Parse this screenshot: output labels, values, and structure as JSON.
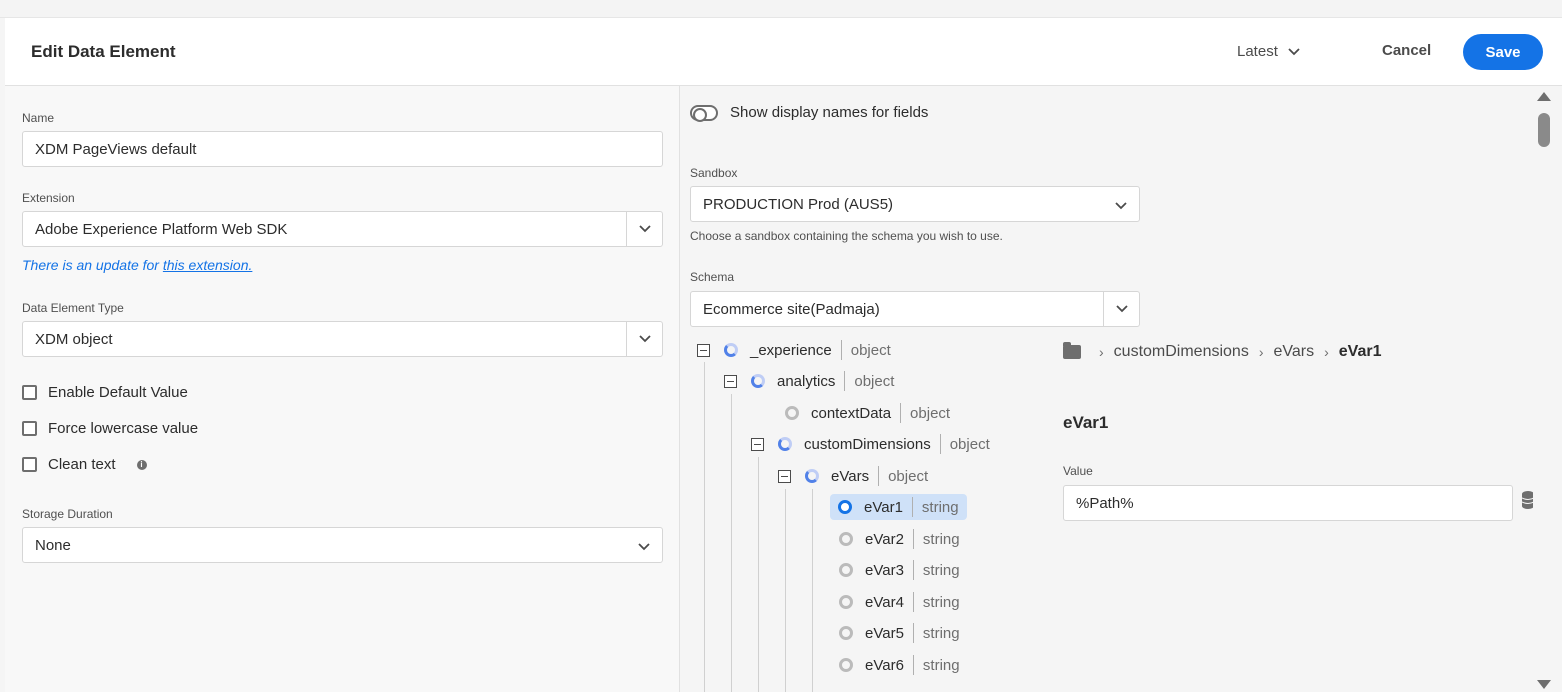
{
  "header": {
    "title": "Edit Data Element",
    "version": "Latest",
    "cancel_label": "Cancel",
    "save_label": "Save"
  },
  "left": {
    "name_label": "Name",
    "name_value": "XDM PageViews default",
    "extension_label": "Extension",
    "extension_value": "Adobe Experience Platform Web SDK",
    "update_note_prefix": "There is an update for ",
    "update_note_link": "this extension.",
    "type_label": "Data Element Type",
    "type_value": "XDM object",
    "checkboxes": [
      {
        "label": "Enable Default Value",
        "checked": false
      },
      {
        "label": "Force lowercase value",
        "checked": false
      },
      {
        "label": "Clean text",
        "checked": false
      }
    ],
    "storage_label": "Storage Duration",
    "storage_value": "None"
  },
  "right": {
    "toggle_label": "Show display names for fields",
    "sandbox_label": "Sandbox",
    "sandbox_value": "PRODUCTION Prod (AUS5)",
    "sandbox_helper": "Choose a sandbox containing the schema you wish to use.",
    "schema_label": "Schema",
    "schema_value": "Ecommerce site(Padmaja)",
    "tree": [
      {
        "name": "_experience",
        "type": "object"
      },
      {
        "name": "analytics",
        "type": "object"
      },
      {
        "name": "contextData",
        "type": "object"
      },
      {
        "name": "customDimensions",
        "type": "object"
      },
      {
        "name": "eVars",
        "type": "object"
      },
      {
        "name": "eVar1",
        "type": "string"
      },
      {
        "name": "eVar2",
        "type": "string"
      },
      {
        "name": "eVar3",
        "type": "string"
      },
      {
        "name": "eVar4",
        "type": "string"
      },
      {
        "name": "eVar5",
        "type": "string"
      },
      {
        "name": "eVar6",
        "type": "string"
      }
    ],
    "breadcrumb": [
      "customDimensions",
      "eVars",
      "eVar1"
    ],
    "detail_title": "eVar1",
    "value_label": "Value",
    "value_input": "%Path%"
  }
}
